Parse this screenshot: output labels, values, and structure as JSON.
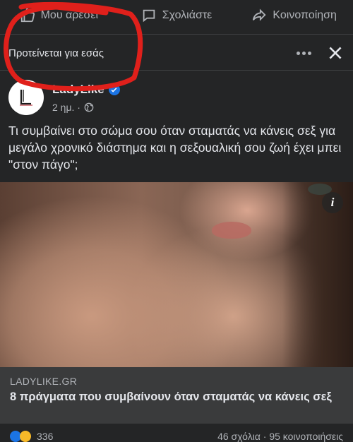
{
  "actions": {
    "like": "Μου αρέσει",
    "comment": "Σχολιάστε",
    "share": "Κοινοποίηση"
  },
  "suggestion": {
    "label": "Προτείνεται για εσάς"
  },
  "post": {
    "author": "LadyLike",
    "time": "2 ημ. ·",
    "text": "Τι συμβαίνει στο σώμα σου όταν σταματάς να κάνεις σεξ για μεγάλο χρονικό διάστημα και η σεξουαλική σου ζωή έχει μπει \"στον πάγο\";"
  },
  "link": {
    "domain": "LADYLIKE.GR",
    "title": "8 πράγματα που συμβαίνουν όταν σταματάς να κάνεις σεξ"
  },
  "footer": {
    "reactions": "336",
    "counts": "46 σχόλια · 95 κοινοποιήσεις"
  },
  "icons": {
    "like": "thumbs-up-icon",
    "comment": "speech-bubble-icon",
    "share": "share-arrow-icon",
    "globe": "globe-icon",
    "info": "info-icon"
  },
  "colors": {
    "background": "#242526",
    "verified": "#1b74e4",
    "annotation": "#e0201b"
  }
}
